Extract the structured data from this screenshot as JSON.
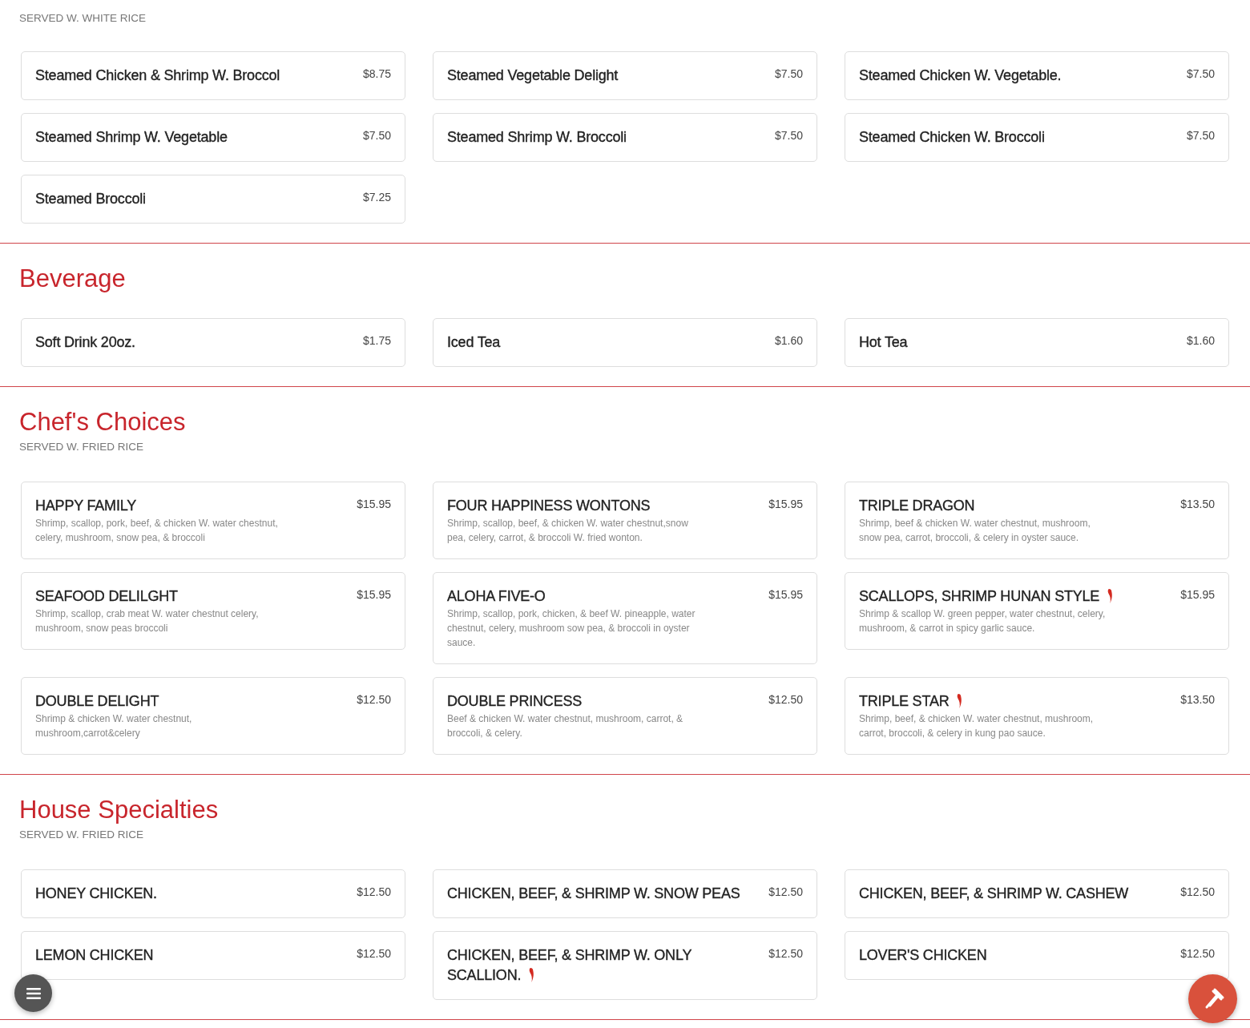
{
  "sections": [
    {
      "subtitle": "SERVED W. WHITE RICE",
      "items": [
        {
          "name": "Steamed Chicken & Shrimp W. Broccol",
          "price": "$8.75",
          "spicy": false
        },
        {
          "name": "Steamed Vegetable Delight",
          "price": "$7.50",
          "spicy": false
        },
        {
          "name": "Steamed Chicken W. Vegetable.",
          "price": "$7.50",
          "spicy": false
        },
        {
          "name": "Steamed Shrimp W. Vegetable",
          "price": "$7.50",
          "spicy": false
        },
        {
          "name": "Steamed Shrimp W. Broccoli",
          "price": "$7.50",
          "spicy": false
        },
        {
          "name": "Steamed Chicken W. Broccoli",
          "price": "$7.50",
          "spicy": false
        },
        {
          "name": "Steamed Broccoli",
          "price": "$7.25",
          "spicy": false
        }
      ]
    },
    {
      "title": "Beverage",
      "items": [
        {
          "name": "Soft Drink 20oz.",
          "price": "$1.75",
          "spicy": false
        },
        {
          "name": "Iced Tea",
          "price": "$1.60",
          "spicy": false
        },
        {
          "name": "Hot Tea",
          "price": "$1.60",
          "spicy": false
        }
      ]
    },
    {
      "title": "Chef's Choices",
      "subtitle": "SERVED W. FRIED RICE",
      "items": [
        {
          "name": "HAPPY FAMILY",
          "price": "$15.95",
          "spicy": false,
          "description": "Shrimp, scallop, pork, beef, & chicken W. water chestnut, celery, mushroom, snow pea, & broccoli"
        },
        {
          "name": "FOUR HAPPINESS WONTONS",
          "price": "$15.95",
          "spicy": false,
          "description": "Shrimp, scallop, beef, & chicken W. water chestnut,snow pea, celery, carrot, & broccoli W. fried wonton."
        },
        {
          "name": "TRIPLE DRAGON",
          "price": "$13.50",
          "spicy": false,
          "description": "Shrimp, beef & chicken W. water chestnut, mushroom, snow pea, carrot, broccoli, & celery in oyster sauce."
        },
        {
          "name": "SEAFOOD DELILGHT",
          "price": "$15.95",
          "spicy": false,
          "description": "Shrimp, scallop, crab meat W. water chestnut celery, mushroom, snow peas broccoli"
        },
        {
          "name": "ALOHA FIVE-O",
          "price": "$15.95",
          "spicy": false,
          "description": "Shrimp, scallop, pork, chicken, & beef W. pineapple, water chestnut, celery, mushroom sow pea, & broccoli in oyster sauce."
        },
        {
          "name": "SCALLOPS, SHRIMP HUNAN STYLE",
          "price": "$15.95",
          "spicy": true,
          "description": "Shrimp & scallop W. green pepper, water chestnut, celery, mushroom, & carrot in spicy garlic sauce."
        },
        {
          "name": "DOUBLE DELIGHT",
          "price": "$12.50",
          "spicy": false,
          "description": "Shrimp & chicken W. water chestnut, mushroom,carrot&celery"
        },
        {
          "name": "DOUBLE PRINCESS",
          "price": "$12.50",
          "spicy": false,
          "description": "Beef & chicken W. water chestnut, mushroom, carrot, & broccoli, & celery."
        },
        {
          "name": "TRIPLE STAR",
          "price": "$13.50",
          "spicy": true,
          "description": "Shrimp, beef, & chicken W. water chestnut, mushroom, carrot, broccoli, & celery in kung pao sauce."
        }
      ]
    },
    {
      "title": "House Specialties",
      "subtitle": "SERVED W. FRIED RICE",
      "items": [
        {
          "name": "HONEY CHICKEN.",
          "price": "$12.50",
          "spicy": false
        },
        {
          "name": "CHICKEN, BEEF, & SHRIMP W. SNOW PEAS",
          "price": "$12.50",
          "spicy": false
        },
        {
          "name": "CHICKEN, BEEF, & SHRIMP W. CASHEW",
          "price": "$12.50",
          "spicy": false
        },
        {
          "name": "LEMON CHICKEN",
          "price": "$12.50",
          "spicy": false
        },
        {
          "name": "CHICKEN, BEEF, & SHRIMP W. ONLY SCALLION.",
          "price": "$12.50",
          "spicy": true
        },
        {
          "name": "LOVER'S CHICKEN",
          "price": "$12.50",
          "spicy": false
        }
      ]
    }
  ]
}
